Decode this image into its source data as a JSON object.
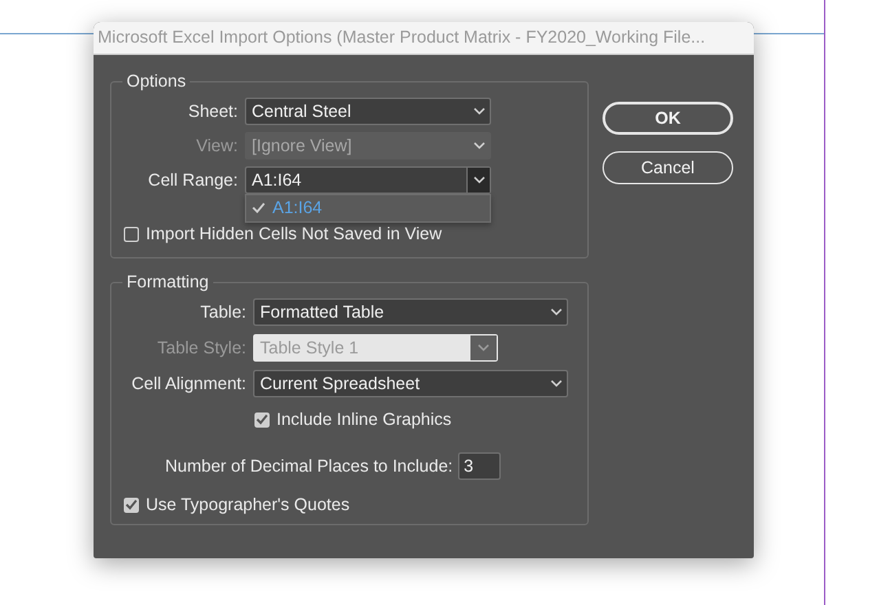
{
  "window": {
    "title": "Microsoft Excel Import Options (Master Product Matrix - FY2020_Working File..."
  },
  "options": {
    "title": "Options",
    "fields": [
      {
        "label": "Sheet:",
        "value": "Central Steel",
        "disabled": false,
        "open": false
      },
      {
        "label": "View:",
        "value": "[Ignore View]",
        "disabled": true,
        "open": false
      },
      {
        "label": "Cell Range:",
        "value": "A1:I64",
        "disabled": false,
        "open": true
      }
    ],
    "menu": [
      {
        "label": "A1:I64",
        "selected": true
      }
    ],
    "hidden_cells": {
      "label": "Import Hidden Cells Not Saved in View",
      "checked": false
    }
  },
  "formatting": {
    "title": "Formatting",
    "fields": [
      {
        "label": "Table:",
        "value": "Formatted Table",
        "disabled": false,
        "open": false
      },
      {
        "label": "Table Style:",
        "value": "Table Style 1",
        "disabled": true,
        "open": false
      },
      {
        "label": "Cell Alignment:",
        "value": "Current Spreadsheet",
        "disabled": false,
        "open": false
      }
    ],
    "inline_graphics": {
      "label": "Include Inline Graphics",
      "checked": true
    },
    "decimal_places": {
      "label": "Number of Decimal Places to Include:",
      "value": "3"
    },
    "quotes": {
      "label": "Use Typographer's Quotes",
      "checked": true
    }
  },
  "buttons": [
    {
      "label": "OK",
      "default": true
    },
    {
      "label": "Cancel",
      "default": false
    }
  ]
}
